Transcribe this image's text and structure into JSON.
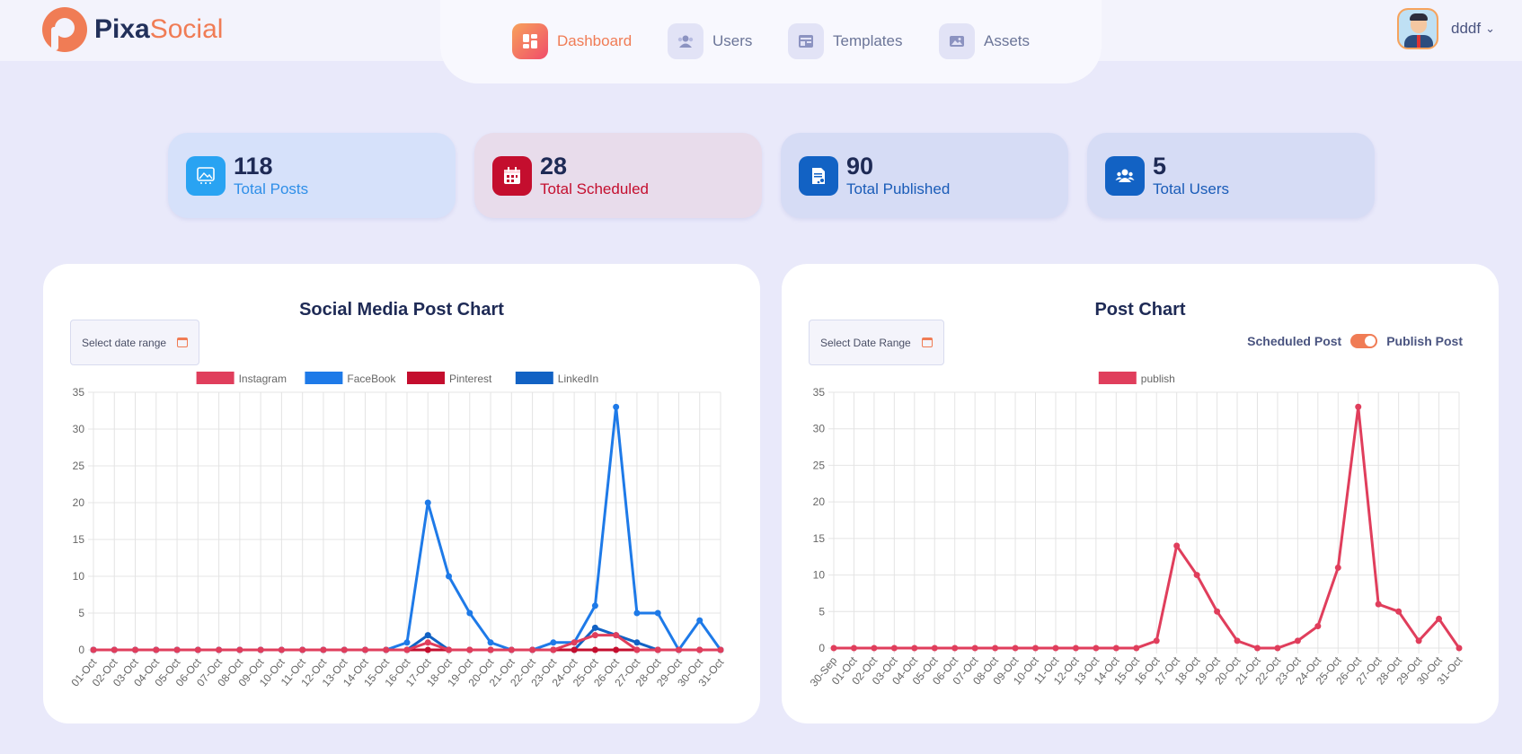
{
  "brand": {
    "name_a": "Pixa",
    "name_b": "Social"
  },
  "nav": [
    {
      "label": "Dashboard",
      "icon": "dashboard-icon",
      "active": true
    },
    {
      "label": "Users",
      "icon": "users-icon",
      "active": false
    },
    {
      "label": "Templates",
      "icon": "templates-icon",
      "active": false
    },
    {
      "label": "Assets",
      "icon": "assets-icon",
      "active": false
    }
  ],
  "user": {
    "name": "dddf"
  },
  "stats": [
    {
      "value": "118",
      "label": "Total Posts",
      "icon": "image-icon",
      "bg": "#d6e1fa",
      "icon_bg": "#29a3f2",
      "label_color": "#2f8fe8"
    },
    {
      "value": "28",
      "label": "Total Scheduled",
      "icon": "calendar-icon",
      "bg": "#e8dceb",
      "icon_bg": "#c40e2e",
      "label_color": "#c40e2e"
    },
    {
      "value": "90",
      "label": "Total Published",
      "icon": "published-doc-icon",
      "bg": "#d6dcf5",
      "icon_bg": "#1262c4",
      "label_color": "#1a5cb8"
    },
    {
      "value": "5",
      "label": "Total Users",
      "icon": "users-group-icon",
      "bg": "#d6dcf5",
      "icon_bg": "#1262c4",
      "label_color": "#1a5cb8"
    }
  ],
  "social_chart": {
    "title": "Social Media Post Chart",
    "date_button": "Select date range"
  },
  "post_chart": {
    "title": "Post Chart",
    "date_button": "Select Date Range",
    "toggle_left": "Scheduled Post",
    "toggle_right": "Publish Post"
  },
  "chart_data": [
    {
      "type": "line",
      "title": "Social Media Post Chart",
      "categories": [
        "01-Oct",
        "02-Oct",
        "03-Oct",
        "04-Oct",
        "05-Oct",
        "06-Oct",
        "07-Oct",
        "08-Oct",
        "09-Oct",
        "10-Oct",
        "11-Oct",
        "12-Oct",
        "13-Oct",
        "14-Oct",
        "15-Oct",
        "16-Oct",
        "17-Oct",
        "18-Oct",
        "19-Oct",
        "20-Oct",
        "21-Oct",
        "22-Oct",
        "23-Oct",
        "24-Oct",
        "25-Oct",
        "26-Oct",
        "27-Oct",
        "28-Oct",
        "29-Oct",
        "30-Oct",
        "31-Oct"
      ],
      "ylim": [
        0,
        35
      ],
      "yticks": [
        0,
        5,
        10,
        15,
        20,
        25,
        30,
        35
      ],
      "legend_position": "top",
      "grid": true,
      "series": [
        {
          "name": "LinkedIn",
          "color": "#1262c4",
          "values": [
            0,
            0,
            0,
            0,
            0,
            0,
            0,
            0,
            0,
            0,
            0,
            0,
            0,
            0,
            0,
            0,
            2,
            0,
            0,
            0,
            0,
            0,
            0,
            0,
            3,
            2,
            1,
            0,
            0,
            0,
            0
          ]
        },
        {
          "name": "Pinterest",
          "color": "#c40e2e",
          "values": [
            0,
            0,
            0,
            0,
            0,
            0,
            0,
            0,
            0,
            0,
            0,
            0,
            0,
            0,
            0,
            0,
            0,
            0,
            0,
            0,
            0,
            0,
            0,
            0,
            0,
            0,
            0,
            0,
            0,
            0,
            0
          ]
        },
        {
          "name": "FaceBook",
          "color": "#1e7ae8",
          "values": [
            0,
            0,
            0,
            0,
            0,
            0,
            0,
            0,
            0,
            0,
            0,
            0,
            0,
            0,
            0,
            1,
            20,
            10,
            5,
            1,
            0,
            0,
            1,
            1,
            6,
            33,
            5,
            5,
            0,
            4,
            0
          ]
        },
        {
          "name": "Instagram",
          "color": "#e03e5c",
          "values": [
            0,
            0,
            0,
            0,
            0,
            0,
            0,
            0,
            0,
            0,
            0,
            0,
            0,
            0,
            0,
            0,
            1,
            0,
            0,
            0,
            0,
            0,
            0,
            1,
            2,
            2,
            0,
            0,
            0,
            0,
            0
          ]
        }
      ],
      "legend_order": [
        "Instagram",
        "FaceBook",
        "Pinterest",
        "LinkedIn"
      ]
    },
    {
      "type": "line",
      "title": "Post Chart",
      "categories": [
        "30-Sep",
        "01-Oct",
        "02-Oct",
        "03-Oct",
        "04-Oct",
        "05-Oct",
        "06-Oct",
        "07-Oct",
        "08-Oct",
        "09-Oct",
        "10-Oct",
        "11-Oct",
        "12-Oct",
        "13-Oct",
        "14-Oct",
        "15-Oct",
        "16-Oct",
        "17-Oct",
        "18-Oct",
        "19-Oct",
        "20-Oct",
        "21-Oct",
        "22-Oct",
        "23-Oct",
        "24-Oct",
        "25-Oct",
        "26-Oct",
        "27-Oct",
        "28-Oct",
        "29-Oct",
        "30-Oct",
        "31-Oct"
      ],
      "ylim": [
        0,
        35
      ],
      "yticks": [
        0,
        5,
        10,
        15,
        20,
        25,
        30,
        35
      ],
      "legend_position": "top",
      "grid": true,
      "series": [
        {
          "name": "publish",
          "color": "#e03e5c",
          "values": [
            0,
            0,
            0,
            0,
            0,
            0,
            0,
            0,
            0,
            0,
            0,
            0,
            0,
            0,
            0,
            0,
            1,
            14,
            10,
            5,
            1,
            0,
            0,
            1,
            3,
            11,
            33,
            6,
            5,
            1,
            4,
            0
          ]
        }
      ],
      "legend_order": [
        "publish"
      ]
    }
  ]
}
